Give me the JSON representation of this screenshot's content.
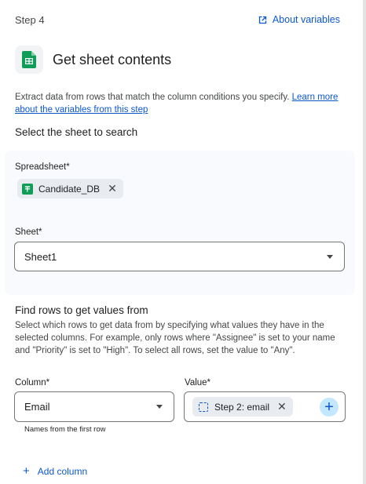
{
  "header": {
    "step": "Step 4",
    "about_link": "About variables",
    "title": "Get sheet contents",
    "description": "Extract data from rows that match the column conditions you specify.",
    "learn_more": "Learn more about the variables from this step"
  },
  "sheet_section": {
    "title": "Select the sheet to search",
    "spreadsheet_label": "Spreadsheet*",
    "spreadsheet_value": "Candidate_DB",
    "sheet_label": "Sheet*",
    "sheet_value": "Sheet1"
  },
  "rows_section": {
    "title": "Find rows to get values from",
    "description": "Select which rows to get data from by specifying what values they have in the selected columns. For example, only rows where \"Assignee\" is set to your name and \"Priority\" is set to \"High\". To select all rows, set the value to \"Any\".",
    "column_label": "Column*",
    "column_value": "Email",
    "value_label": "Value*",
    "value_chip": "Step 2: email",
    "column_hint": "Names from the first row",
    "add_column": "Add column"
  },
  "colors": {
    "accent": "#0b57d0",
    "sheets_green": "#0f9d58",
    "card_bg": "#f8fafd"
  },
  "icons": [
    "open-in-new-icon",
    "google-sheets-icon",
    "close-icon",
    "dropdown-caret-icon",
    "variable-icon",
    "plus-icon"
  ]
}
